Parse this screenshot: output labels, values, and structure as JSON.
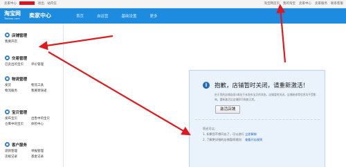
{
  "topbar": {
    "welcome": "卖家中心",
    "logout": "退出",
    "messages": "站内信",
    "links": [
      "淘宝网首页",
      "我的淘宝",
      "卖家中心",
      "卖家服务",
      "联系客服"
    ]
  },
  "header": {
    "logo_cn": "淘宝网",
    "logo_en": "Taobao.com",
    "title": "卖家中心",
    "nav": [
      "首页",
      "自运营",
      "基础设置",
      "更多"
    ]
  },
  "sidebar": {
    "sections": [
      {
        "title": "店铺管理",
        "links": [
          "我要开店"
        ]
      },
      {
        "title": "交易管理",
        "links": [
          "已卖出的宝贝",
          "评价管理"
        ]
      },
      {
        "title": "物流管理",
        "links": [
          "发货",
          "物流工具",
          "物流服务",
          "我要寄快递"
        ]
      },
      {
        "title": "宝贝管理",
        "links": [
          "发布宝贝",
          "出售中的宝贝",
          "仓库中的宝贝",
          "体检中心"
        ]
      },
      {
        "title": "客户服务",
        "links": [
          "退款管理",
          "举报管理",
          "违规记录",
          "基金记录"
        ]
      }
    ]
  },
  "notice": {
    "icon": "info-icon",
    "title": "抱歉，店铺暂时关闭，请重新激活！",
    "description": "由于您的店铺连续5周处于未发布宝贝的状态，店铺暂时关闭，店铺装修等信息均不受影响，重新激活后店铺即可恢复正常。",
    "button": "激活店铺",
    "tips_title": "您还可以：",
    "tip1_text": "1. 如果您不想开店了，可以进行",
    "tip1_link": "立即解绑",
    "tip2_text": "2. 了解更详细的店铺暂停规则：",
    "tip2_link": "查看开店规则"
  },
  "colors": {
    "header_blue": "#1c8be0",
    "annotation_red": "#e0191e",
    "notice_bg": "#eaf3fb"
  }
}
